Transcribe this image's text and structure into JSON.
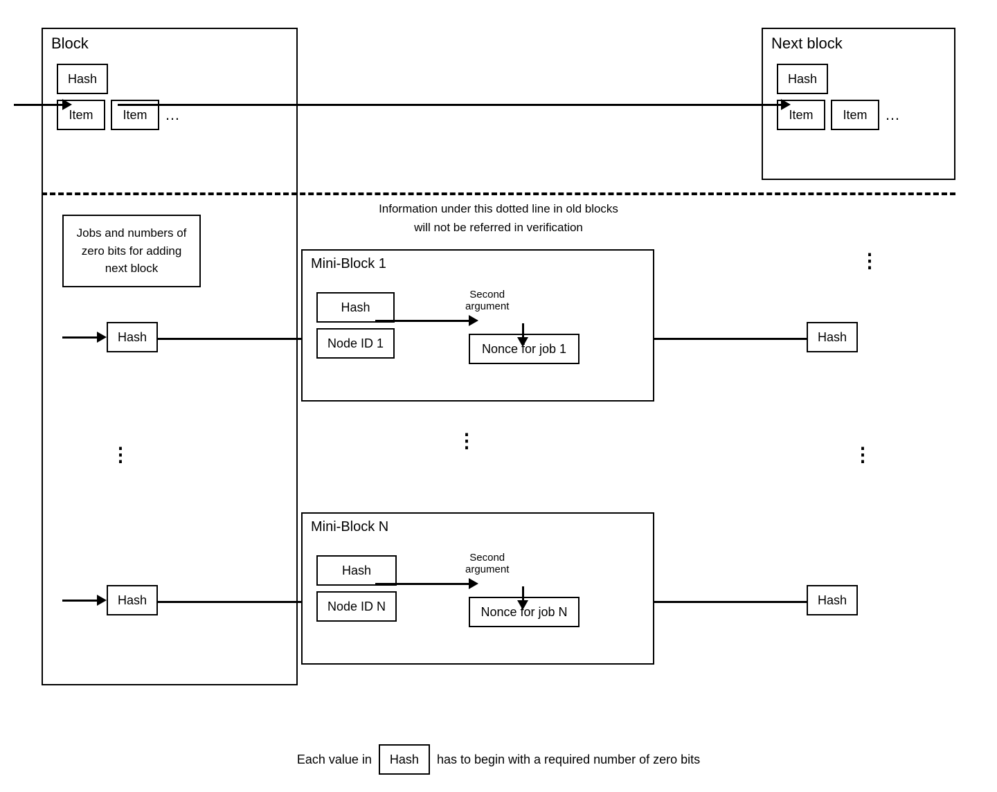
{
  "diagram": {
    "block_label": "Block",
    "next_block_label": "Next block",
    "hash_label": "Hash",
    "item_label": "Item",
    "ellipsis": "…",
    "dots_vertical": "⋮",
    "dashed_info": "Information under this dotted line in old blocks\nwill not be referred in verification",
    "jobs_text": "Jobs and numbers of zero bits for adding next block",
    "mini_block_1_label": "Mini-Block 1",
    "mini_block_n_label": "Mini-Block N",
    "node_id_1": "Node ID 1",
    "node_id_n": "Node ID N",
    "nonce_for_job_1": "Nonce for job 1",
    "nonce_for_job_n": "Nonce for job N",
    "second_argument": "Second\nargument",
    "footer_prefix": "Each value in",
    "footer_hash": "Hash",
    "footer_suffix": "has to begin with a required number of zero bits"
  }
}
